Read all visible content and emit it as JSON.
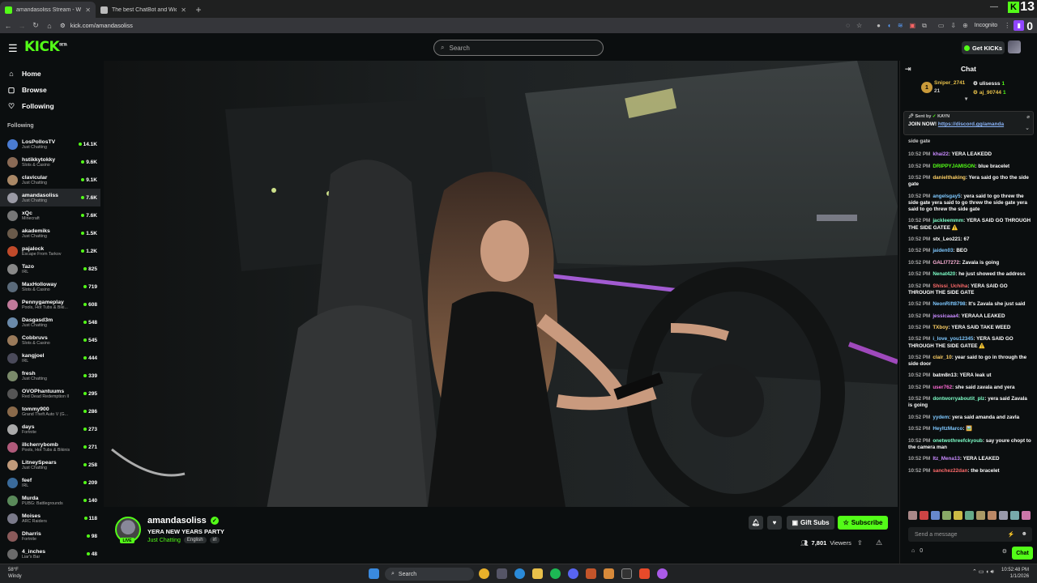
{
  "browser": {
    "tabs": [
      {
        "title": "amandasoliss Stream - Wat",
        "active": true,
        "color": "#53fc18"
      },
      {
        "title": "The best ChatBot and Widgets",
        "active": false,
        "color": "#bbbbbb"
      }
    ],
    "url": "kick.com/amandasoliss",
    "incognito_label": "Incognito",
    "corner_count": "13",
    "corner_badge": "K",
    "ext_count": "0"
  },
  "header": {
    "logo": "KICK",
    "logo_beta": "BETA",
    "search_placeholder": "Search",
    "get_kicks": "Get KICKs"
  },
  "sidebar": {
    "nav": [
      {
        "label": "Home",
        "icon": "home-icon"
      },
      {
        "label": "Browse",
        "icon": "browse-icon"
      },
      {
        "label": "Following",
        "icon": "heart-icon"
      }
    ],
    "following_heading": "Following",
    "channels": [
      {
        "name": "LosPollosTV",
        "category": "Just Chatting",
        "viewers": "14.1K",
        "color": "#4a7bd1"
      },
      {
        "name": "hstikkytokky",
        "category": "Slots & Casino",
        "viewers": "9.6K",
        "color": "#8a6a55"
      },
      {
        "name": "clavicular",
        "category": "Just Chatting",
        "viewers": "9.1K",
        "color": "#aa8866"
      },
      {
        "name": "amandasoliss",
        "category": "Just Chatting",
        "viewers": "7.6K",
        "color": "#9a9aa5",
        "active": true
      },
      {
        "name": "xQc",
        "category": "Minecraft",
        "viewers": "7.6K",
        "color": "#777777"
      },
      {
        "name": "akademiks",
        "category": "Just Chatting",
        "viewers": "1.5K",
        "color": "#6a5a4a"
      },
      {
        "name": "pajalock",
        "category": "Escape From Tarkov",
        "viewers": "1.2K",
        "color": "#c04a2a"
      },
      {
        "name": "Tazo",
        "category": "IRL",
        "viewers": "825",
        "color": "#888888"
      },
      {
        "name": "MaxHolloway",
        "category": "Slots & Casino",
        "viewers": "719",
        "color": "#5a6a7a"
      },
      {
        "name": "Pennygameplay",
        "category": "Pools, Hot Tubs & Biki...",
        "viewers": "608",
        "color": "#c07a9a"
      },
      {
        "name": "Dasgasd3m",
        "category": "Just Chatting",
        "viewers": "548",
        "color": "#6a8aaa"
      },
      {
        "name": "Cobbruvs",
        "category": "Slots & Casino",
        "viewers": "545",
        "color": "#9a7a5a"
      },
      {
        "name": "kangjoel",
        "category": "IRL",
        "viewers": "444",
        "color": "#4a4a5a"
      },
      {
        "name": "fresh",
        "category": "Just Chatting",
        "viewers": "339",
        "color": "#7a8a6a"
      },
      {
        "name": "OVOPhantuums",
        "category": "Red Dead Redemption II",
        "viewers": "295",
        "color": "#555555"
      },
      {
        "name": "tommy900",
        "category": "Grand Theft Auto V (G...",
        "viewers": "286",
        "color": "#8a6a4a"
      },
      {
        "name": "days",
        "category": "Fortnite",
        "viewers": "273",
        "color": "#aaaaaa"
      },
      {
        "name": "illcherrybomb",
        "category": "Pools, Hot Tubs & Bikinis",
        "viewers": "271",
        "color": "#b05a7a"
      },
      {
        "name": "LitneySpears",
        "category": "Just Chatting",
        "viewers": "258",
        "color": "#c09a7a"
      },
      {
        "name": "feef",
        "category": "IRL",
        "viewers": "209",
        "color": "#3a6a9a"
      },
      {
        "name": "Murda",
        "category": "PUBG: Battlegrounds",
        "viewers": "140",
        "color": "#5a8a5a"
      },
      {
        "name": "Moises",
        "category": "ARC Raiders",
        "viewers": "118",
        "color": "#7a7a8a"
      },
      {
        "name": "Dharris",
        "category": "Fortnite",
        "viewers": "98",
        "color": "#8a5a5a"
      },
      {
        "name": "4_inches",
        "category": "Liar's Bar",
        "viewers": "48",
        "color": "#6a6a6a"
      }
    ]
  },
  "stream": {
    "name": "amandasoliss",
    "title": "YERA NEW YEARS PARTY",
    "category": "Just Chatting",
    "tags": [
      "English",
      "irl"
    ],
    "live": "LIVE",
    "gift_subs": "Gift Subs",
    "subscribe": "Subscribe",
    "viewers": "7,801",
    "viewers_label": "Viewers"
  },
  "chat": {
    "title": "Chat",
    "gifters": [
      {
        "name": "Sniper_2741",
        "count": "21",
        "rank": "1",
        "color": "#e8c14a"
      },
      {
        "name": "ulisesss",
        "count": "1",
        "color": "#ffffff"
      },
      {
        "name": "aj_90744",
        "count": "1",
        "color": "#e8c14a"
      }
    ],
    "pinned": {
      "sent_by": "Sent by",
      "sender": "KAYN",
      "text": "JOIN NOW!",
      "link": "https://discord.gg/amanda"
    },
    "partial_line": "side gate",
    "messages": [
      {
        "time": "10:52 PM",
        "user": "khai22",
        "color": "#c98bff",
        "text": "YERA LEAKEDD"
      },
      {
        "time": "10:52 PM",
        "user": "DRIPPYJAMISON",
        "color": "#53fc18",
        "text": "blue bracelet"
      },
      {
        "time": "10:52 PM",
        "user": "danielthaking",
        "color": "#ffd166",
        "text": "Yera said go tho the side gate"
      },
      {
        "time": "10:52 PM",
        "user": "angelsgay5",
        "color": "#7ec8ff",
        "text": "yera said to go threw the side gate yera said to go threw the side gate yera said to go threw the side gate"
      },
      {
        "time": "10:52 PM",
        "user": "jackleemmm",
        "color": "#7effc8",
        "text": "YERA SAID GO THROUGH THE SIDE GATEE ⚠️"
      },
      {
        "time": "10:52 PM",
        "user": "stx_Leo221",
        "color": "#ffffff",
        "text": "67"
      },
      {
        "time": "10:52 PM",
        "user": "jaiden03",
        "color": "#7ec8ff",
        "text": "BEO"
      },
      {
        "time": "10:52 PM",
        "user": "GALI77272",
        "color": "#ffb3d9",
        "text": "Zavala is going"
      },
      {
        "time": "10:52 PM",
        "user": "Nenat420",
        "color": "#7effc8",
        "text": "he just showed the address"
      },
      {
        "time": "10:52 PM",
        "user": "Shissi_Uchiha",
        "color": "#ff6b6b",
        "text": "YERA SAID GO THROUGH THE SIDE GATE"
      },
      {
        "time": "10:52 PM",
        "user": "NeonRift8798",
        "color": "#7ec8ff",
        "text": "It's Zavala she just said"
      },
      {
        "time": "10:52 PM",
        "user": "jessicaaa4",
        "color": "#c98bff",
        "text": "YERAAA LEAKED"
      },
      {
        "time": "10:52 PM",
        "user": "TXboy",
        "color": "#ffd166",
        "text": "YERA SAID TAKE WEED"
      },
      {
        "time": "10:52 PM",
        "user": "i_love_you12345",
        "color": "#7ec8ff",
        "text": "YERA SAID GO THROUGH THE SIDE GATEE ⚠️"
      },
      {
        "time": "10:52 PM",
        "user": "clair_10",
        "color": "#ffd166",
        "text": "year said to go in through the side door"
      },
      {
        "time": "10:52 PM",
        "user": "batm8n13",
        "color": "#ffffff",
        "text": "YERA leak ut"
      },
      {
        "time": "10:52 PM",
        "user": "user762",
        "color": "#ff6bd5",
        "text": "she said zavala and yera"
      },
      {
        "time": "10:52 PM",
        "user": "dontworryaboutit_plz",
        "color": "#7effc8",
        "text": "yera said Zavala is going"
      },
      {
        "time": "10:52 PM",
        "user": "yydem",
        "color": "#7ec8ff",
        "text": "yera said amanda and zavla"
      },
      {
        "time": "10:52 PM",
        "user": "HeyItzMarco",
        "color": "#7ec8ff",
        "text": "🖼️"
      },
      {
        "time": "10:52 PM",
        "user": "onetwothreefckyoub",
        "color": "#7effc8",
        "text": "say youre chopt to the camera man"
      },
      {
        "time": "10:52 PM",
        "user": "Itz_Mena13",
        "color": "#c98bff",
        "text": "YERA LEAKED"
      },
      {
        "time": "10:52 PM",
        "user": "sanchez22dan",
        "color": "#ff6b6b",
        "text": "the bracelet"
      }
    ],
    "input_placeholder": "Send a message",
    "points": "0",
    "chat_button": "Chat"
  },
  "taskbar": {
    "weather_temp": "58°F",
    "weather_desc": "Windy",
    "search": "Search",
    "time": "10:52:48 PM",
    "date": "1/1/2026"
  }
}
